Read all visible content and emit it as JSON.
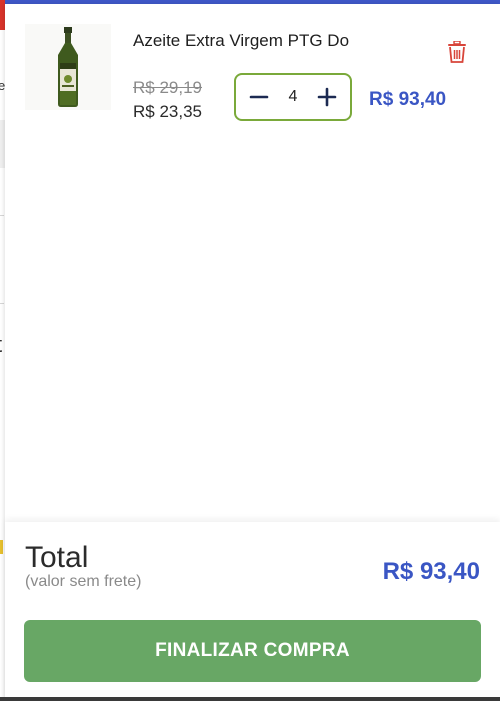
{
  "cart": {
    "item": {
      "name": "Azeite Extra Virgem PTG Do",
      "old_price": "R$ 29,19",
      "price": "R$ 23,35",
      "quantity": "4",
      "line_total": "R$ 93,40",
      "icons": {
        "remove": "trash-icon",
        "decrease": "minus-icon",
        "increase": "plus-icon"
      }
    },
    "summary": {
      "label": "Total",
      "sublabel": "(valor sem frete)",
      "value": "R$ 93,40"
    },
    "checkout_label": "FINALIZAR COMPRA"
  },
  "background": {
    "glyph_e": "e",
    "glyph_t": "t"
  },
  "colors": {
    "accent_blue": "#3a56c4",
    "top_bar": "#3f58c8",
    "stepper_border": "#7aa93a",
    "checkout_green": "#68a765",
    "trash_red": "#d8453a"
  }
}
